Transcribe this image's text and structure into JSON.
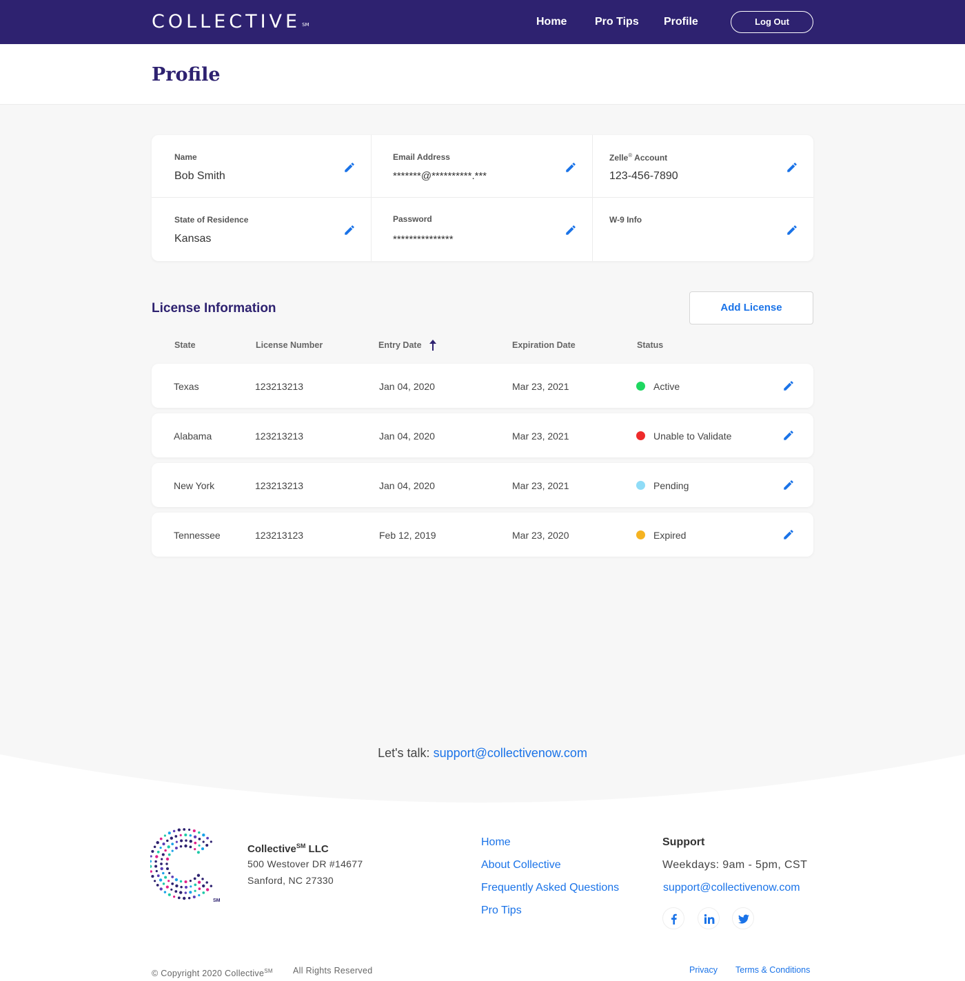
{
  "header": {
    "logo_text": "COLLECTIVE",
    "logo_mark": "SM",
    "nav": [
      {
        "label": "Home"
      },
      {
        "label": "Pro Tips"
      },
      {
        "label": "Profile"
      }
    ],
    "active_nav": "Profile",
    "logout_label": "Log Out"
  },
  "page": {
    "title": "Profile"
  },
  "profile": {
    "name": {
      "label": "Name",
      "value": "Bob Smith"
    },
    "email": {
      "label": "Email Address",
      "value": "*******@**********.***"
    },
    "zelle": {
      "label_prefix": "Zelle",
      "label_mark": "®",
      "label_suffix": " Account",
      "value": "123-456-7890"
    },
    "state": {
      "label": "State of Residence",
      "value": "Kansas"
    },
    "password": {
      "label": "Password",
      "value": "***************"
    },
    "w9": {
      "label": "W-9 Info",
      "value": ""
    }
  },
  "license": {
    "title": "License Information",
    "add_label": "Add License",
    "columns": [
      "State",
      "License Number",
      "Entry Date",
      "Expiration Date",
      "Status"
    ],
    "sort_column": "Entry Date",
    "sort_direction": "ascending",
    "rows": [
      {
        "state": "Texas",
        "number": "123213213",
        "entry": "Jan 04, 2020",
        "expiration": "Mar 23, 2021",
        "status": "Active",
        "status_color": "#1ed760"
      },
      {
        "state": "Alabama",
        "number": "123213213",
        "entry": "Jan 04, 2020",
        "expiration": "Mar 23, 2021",
        "status": "Unable to Validate",
        "status_color": "#ee2b2b"
      },
      {
        "state": "New York",
        "number": "123213213",
        "entry": "Jan 04, 2020",
        "expiration": "Mar 23, 2021",
        "status": "Pending",
        "status_color": "#8fdcf7"
      },
      {
        "state": "Tennessee",
        "number": "123213123",
        "entry": "Feb 12, 2019",
        "expiration": "Mar 23, 2020",
        "status": "Expired",
        "status_color": "#f5b321"
      }
    ]
  },
  "footer": {
    "lets_talk": "Let's talk:",
    "contact_email": "support@collectivenow.com",
    "company_name": "Collective",
    "company_mark": "SM",
    "company_suffix": " LLC",
    "address_line1": "500 Westover DR #14677",
    "address_line2": "Sanford, NC 27330",
    "links": [
      "Home",
      "About Collective",
      "Frequently Asked Questions",
      "Pro Tips"
    ],
    "support_heading": "Support",
    "support_hours": "Weekdays: 9am - 5pm, CST",
    "support_email": "support@collectivenow.com",
    "social": [
      "facebook-icon",
      "linkedin-icon",
      "twitter-icon"
    ],
    "copyright_prefix": "© Copyright 2020 Collective",
    "copyright_mark": "SM",
    "rights": "All Rights Reserved",
    "privacy": "Privacy",
    "terms": "Terms & Conditions"
  },
  "colors": {
    "brand": "#2e2270",
    "link": "#1a73e8",
    "background": "#f7f7f7"
  }
}
